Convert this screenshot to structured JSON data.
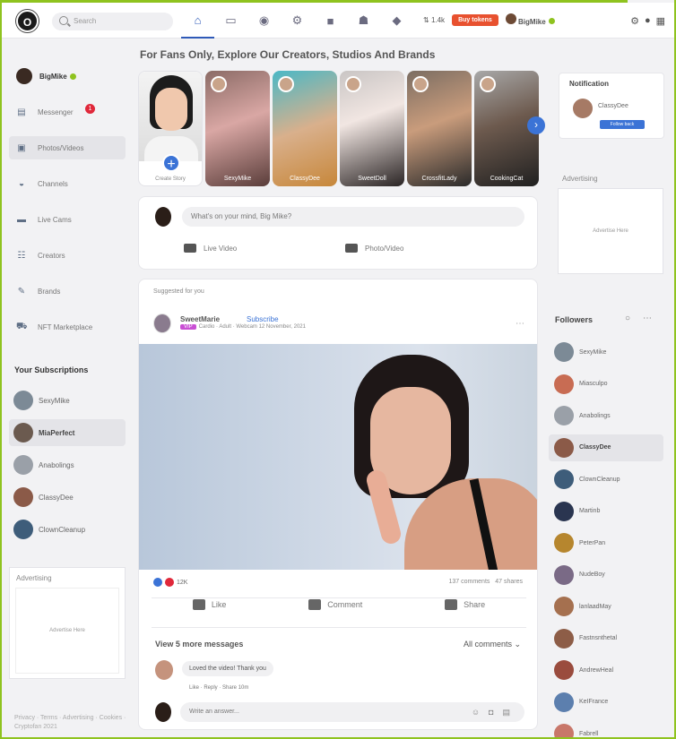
{
  "header": {
    "logo": "O",
    "search_placeholder": "Search",
    "nav": [
      {
        "icon": "home-icon",
        "glyph": "⌂",
        "active": true
      },
      {
        "icon": "monitor-icon",
        "glyph": "▭",
        "active": false
      },
      {
        "icon": "compass-icon",
        "glyph": "◉",
        "active": false
      },
      {
        "icon": "settings-icon",
        "glyph": "⚙",
        "active": false
      },
      {
        "icon": "video-icon",
        "glyph": "■",
        "active": false
      },
      {
        "icon": "users-icon",
        "glyph": "☗",
        "active": false
      },
      {
        "icon": "tag-icon",
        "glyph": "◆",
        "active": false
      }
    ],
    "token_label": "1.4k",
    "buy_label": "Buy tokens",
    "user_name": "BigMike"
  },
  "left": {
    "user_name": "BigMike",
    "menu": [
      {
        "name": "messenger",
        "label": "Messenger",
        "icon": "chat-icon",
        "glyph": "▤",
        "badge": "1"
      },
      {
        "name": "photos-videos",
        "label": "Photos/Videos",
        "icon": "photo-icon",
        "glyph": "▣",
        "active": true
      },
      {
        "name": "channels",
        "label": "Channels",
        "icon": "channel-icon",
        "glyph": "◒"
      },
      {
        "name": "live-cams",
        "label": "Live Cams",
        "icon": "camera-icon",
        "glyph": "▬"
      },
      {
        "name": "creators",
        "label": "Creators",
        "icon": "group-icon",
        "glyph": "☷"
      },
      {
        "name": "brands",
        "label": "Brands",
        "icon": "brand-icon",
        "glyph": "✎"
      },
      {
        "name": "nft-marketplace",
        "label": "NFT Marketplace",
        "icon": "cart-icon",
        "glyph": "⛟"
      }
    ],
    "subscriptions_title": "Your Subscriptions",
    "subscriptions": [
      {
        "label": "SexyMike",
        "color": "#7c8a96"
      },
      {
        "label": "MiaPerfect",
        "color": "#6b5a4f",
        "active": true
      },
      {
        "label": "Anabolings",
        "color": "#9aa0a8"
      },
      {
        "label": "ClassyDee",
        "color": "#8b5a48"
      },
      {
        "label": "ClownCleanup",
        "color": "#3e5d7a"
      }
    ],
    "ad_title": "Advertising",
    "ad_box": "Advertise Here",
    "footer": "Privacy · Terms · Advertising · Cookies · Cryptofan 2021"
  },
  "center": {
    "headline": "For Fans Only, Explore Our Creators, Studios And Brands",
    "create_story": "Create Story",
    "stories": [
      {
        "label": "SexyMike",
        "bg": "linear-gradient(160deg,#8b6b66,#d9a7a4 45%,#5a3d3a)"
      },
      {
        "label": "ClassyDee",
        "bg": "linear-gradient(160deg,#4ab8c6,#d9b08c 50%,#c7873a)"
      },
      {
        "label": "SweetDoll",
        "bg": "linear-gradient(160deg,#c9c5c4,#f1e6e2 40%,#2a2424)"
      },
      {
        "label": "CrossfitLady",
        "bg": "linear-gradient(160deg,#7b6d62,#c99c7c 45%,#2a2a2a)"
      },
      {
        "label": "CookingCat",
        "bg": "linear-gradient(160deg,#a8a8a8,#6d5a4e 45%,#202020)"
      }
    ],
    "composer_placeholder": "What's on your mind, Big Mike?",
    "live_video": "Live Video",
    "photo_video": "Photo/Video",
    "post": {
      "suggested": "Suggested for you",
      "author": "SweetMarie",
      "subscribe": "Subscribe",
      "tag": "VIP",
      "meta": "Cardio · Adult · Webcam   12 November, 2021",
      "likes": "12K",
      "comments": "137 comments",
      "shares": "47 shares",
      "like_label": "Like",
      "comment_label": "Comment",
      "share_label": "Share",
      "view_more": "View 5 more messages",
      "all_comments": "All comments ⌄",
      "comment_text": "Loved the video! Thank you",
      "comment_actions": "Like · Reply · Share   10m",
      "write_placeholder": "Write an answer..."
    }
  },
  "right": {
    "notification_title": "Notification",
    "notification_name": "ClassyDee",
    "notification_button": "Follow back",
    "ad_title": "Advertising",
    "ad_box": "Advertise Here",
    "followers_title": "Followers",
    "followers": [
      {
        "label": "SexyMike",
        "color": "#7c8a96"
      },
      {
        "label": "Miasculpo",
        "color": "#c86c53"
      },
      {
        "label": "Anabolings",
        "color": "#9aa0a8"
      },
      {
        "label": "ClassyDee",
        "color": "#8b5a48",
        "active": true
      },
      {
        "label": "ClownCleanup",
        "color": "#3e5d7a"
      },
      {
        "label": "Martinb",
        "color": "#2a3550"
      },
      {
        "label": "PeterPan",
        "color": "#b6862e"
      },
      {
        "label": "NudeBoy",
        "color": "#7a6a86"
      },
      {
        "label": "lanlaadMay",
        "color": "#a5704f"
      },
      {
        "label": "Fastnsnthetal",
        "color": "#8d5d47"
      },
      {
        "label": "AndrewHeal",
        "color": "#9a4c3e"
      },
      {
        "label": "KeIFrance",
        "color": "#5c7fae"
      },
      {
        "label": "Fabrell",
        "color": "#c8776a"
      }
    ]
  }
}
